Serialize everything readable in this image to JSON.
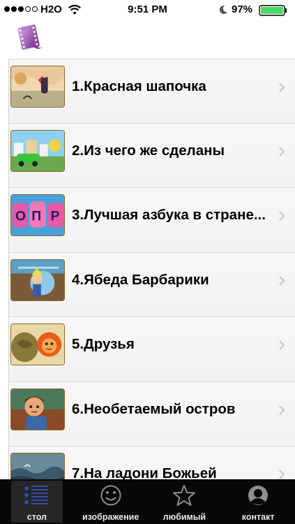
{
  "status_bar": {
    "carrier": "H2O",
    "time": "9:51 PM",
    "battery": "97%"
  },
  "colors": {
    "tab_bar_bg": "#080808",
    "battery_fill": "#4cd964",
    "active_tab_icon": "#2a54d6"
  },
  "list": {
    "items": [
      {
        "title": "1.Красная шапочка",
        "icon": "cartoon-thumbnail"
      },
      {
        "title": "2.Из чего же сделаны",
        "icon": "cartoon-thumbnail"
      },
      {
        "title": "3.Лучшая азбука в стране...",
        "icon": "cartoon-thumbnail"
      },
      {
        "title": "4.Ябеда Барбарики",
        "icon": "cartoon-thumbnail"
      },
      {
        "title": "5.Друзья",
        "icon": "cartoon-thumbnail"
      },
      {
        "title": "6.Необетаемый остров",
        "icon": "cartoon-thumbnail"
      },
      {
        "title": "7.На ладони Божьей",
        "icon": "cartoon-thumbnail"
      }
    ]
  },
  "tab_bar": {
    "tabs": [
      {
        "label": "стол",
        "icon": "list-icon",
        "active": true
      },
      {
        "label": "изображение",
        "icon": "smiley-icon",
        "active": false
      },
      {
        "label": "любимый",
        "icon": "star-icon",
        "active": false
      },
      {
        "label": "контакт",
        "icon": "contact-icon",
        "active": false
      }
    ]
  }
}
